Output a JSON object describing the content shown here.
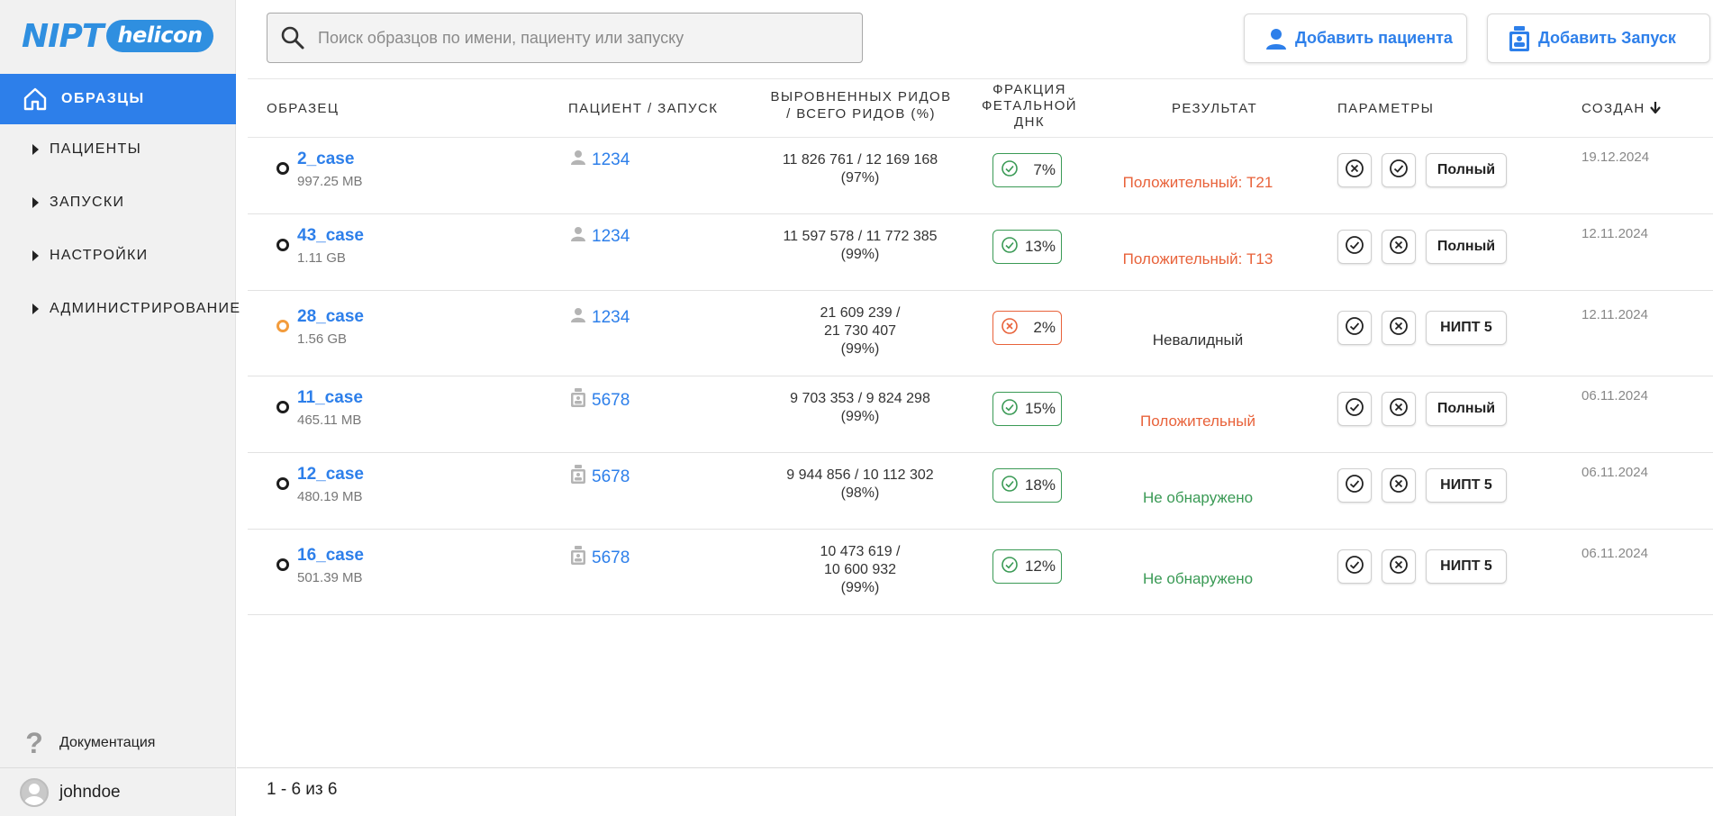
{
  "logo": {
    "primary": "NIPT",
    "secondary": "helicon"
  },
  "sidebar": {
    "active": {
      "label": "ОБРАЗЦЫ"
    },
    "items": [
      {
        "label": "ПАЦИЕНТЫ"
      },
      {
        "label": "ЗАПУСКИ"
      },
      {
        "label": "НАСТРОЙКИ"
      },
      {
        "label": "АДМИНИСТРИРОВАНИЕ"
      }
    ],
    "docs_label": "Документация",
    "username": "johndoe"
  },
  "search": {
    "placeholder": "Поиск образцов по имени, пациенту или запуску"
  },
  "toolbar": {
    "add_patient_label": "Добавить пациента",
    "add_run_label": "Добавить Запуск",
    "accent_color": "#2d7fea"
  },
  "table": {
    "headers": {
      "sample": "ОБРАЗЕЦ",
      "patient_run": "ПАЦИЕНТ / ЗАПУСК",
      "reads_l1": "ВЫРОВНЕННЫХ РИДОВ",
      "reads_l2": "/ ВСЕГО РИДОВ (%)",
      "fraction_l1": "ФРАКЦИЯ",
      "fraction_l2": "ФЕТАЛЬНОЙ",
      "fraction_l3": "ДНК",
      "result": "РЕЗУЛЬТАТ",
      "params": "ПАРАМЕТРЫ",
      "created": "СОЗДАН"
    },
    "rows": [
      {
        "name": "2_case",
        "size": "997.25 MB",
        "status": "dark",
        "id_icon": "person-icon",
        "id": "1234",
        "reads_l1": "11 826 761 / 12 169 168",
        "reads_l2": "(97%)",
        "reads_l3": "",
        "fraction": "7%",
        "fraction_ok": true,
        "result": "Положительный: T21",
        "result_kind": "pos",
        "param1": "x-circle-icon",
        "param2": "check-circle-icon",
        "mode": "Полный",
        "date": "19.12.2024"
      },
      {
        "name": "43_case",
        "size": "1.11 GB",
        "status": "dark",
        "id_icon": "person-icon",
        "id": "1234",
        "reads_l1": "11 597 578 / 11 772 385",
        "reads_l2": "(99%)",
        "reads_l3": "",
        "fraction": "13%",
        "fraction_ok": true,
        "result": "Положительный: T13",
        "result_kind": "pos",
        "param1": "check-circle-icon",
        "param2": "x-circle-icon",
        "mode": "Полный",
        "date": "12.11.2024"
      },
      {
        "name": "28_case",
        "size": "1.56 GB",
        "status": "orange",
        "id_icon": "person-icon",
        "id": "1234",
        "reads_l1": "21 609 239 /",
        "reads_l2": "21 730 407",
        "reads_l3": "(99%)",
        "fraction": "2%",
        "fraction_ok": false,
        "result": "Невалидный",
        "result_kind": "neu",
        "param1": "check-circle-icon",
        "param2": "x-circle-icon",
        "mode": "НИПТ 5",
        "date": "12.11.2024"
      },
      {
        "name": "11_case",
        "size": "465.11 MB",
        "status": "dark",
        "id_icon": "run-icon",
        "id": "5678",
        "reads_l1": "9 703 353 / 9 824 298",
        "reads_l2": "(99%)",
        "reads_l3": "",
        "fraction": "15%",
        "fraction_ok": true,
        "result": "Положительный",
        "result_kind": "pos",
        "param1": "check-circle-icon",
        "param2": "x-circle-icon",
        "mode": "Полный",
        "date": "06.11.2024"
      },
      {
        "name": "12_case",
        "size": "480.19 MB",
        "status": "dark",
        "id_icon": "run-icon",
        "id": "5678",
        "reads_l1": "9 944 856 / 10 112 302",
        "reads_l2": "(98%)",
        "reads_l3": "",
        "fraction": "18%",
        "fraction_ok": true,
        "result": "Не обнаружено",
        "result_kind": "neg",
        "param1": "check-circle-icon",
        "param2": "x-circle-icon",
        "mode": "НИПТ 5",
        "date": "06.11.2024"
      },
      {
        "name": "16_case",
        "size": "501.39 MB",
        "status": "dark",
        "id_icon": "run-icon",
        "id": "5678",
        "reads_l1": "10 473 619 /",
        "reads_l2": "10 600 932",
        "reads_l3": "(99%)",
        "fraction": "12%",
        "fraction_ok": true,
        "result": "Не обнаружено",
        "result_kind": "neg",
        "param1": "check-circle-icon",
        "param2": "x-circle-icon",
        "mode": "НИПТ 5",
        "date": "06.11.2024"
      }
    ]
  },
  "pager": {
    "text": "1 - 6 из 6"
  },
  "colors": {
    "positive": "#e8623a",
    "negative": "#3a9a55",
    "link": "#2d7fea"
  }
}
